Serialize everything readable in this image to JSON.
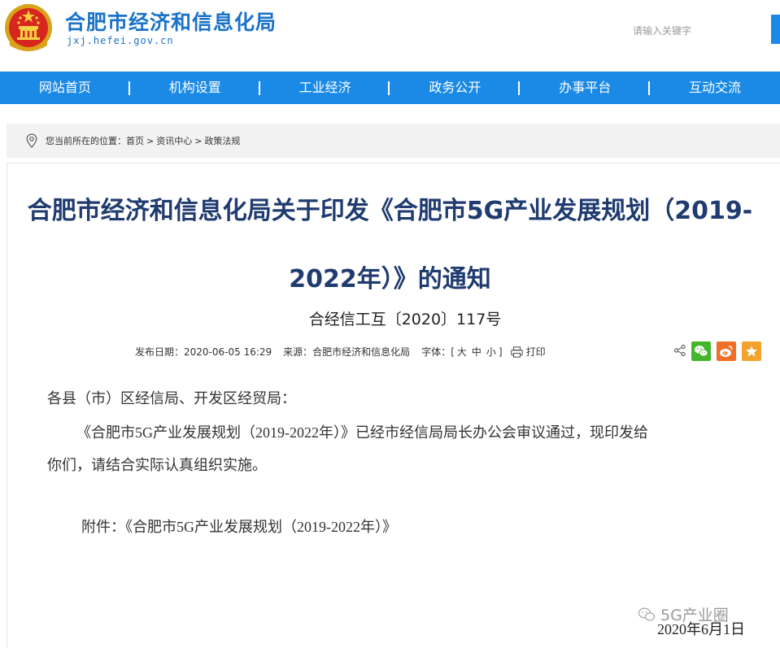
{
  "header": {
    "site_title": "合肥市经济和信息化局",
    "site_domain": "jxj.hefei.gov.cn",
    "search_placeholder": "请输入关键字"
  },
  "nav": {
    "items": [
      "网站首页",
      "机构设置",
      "工业经济",
      "政务公开",
      "办事平台",
      "互动交流"
    ]
  },
  "breadcrumb": {
    "prefix": "您当前所在的位置：",
    "items": [
      "首页",
      "资讯中心",
      "政策法规"
    ],
    "separator": ">"
  },
  "article": {
    "title": "合肥市经济和信息化局关于印发《合肥市5G产业发展规划（2019-2022年）》的通知",
    "doc_number": "合经信工互〔2020〕117号",
    "meta": {
      "date_label": "发布日期：",
      "date_value": "2020-06-05 16:29",
      "source_label": "来源：",
      "source_value": "合肥市经济和信息化局",
      "font_label": "字体：[",
      "font_large": "大",
      "font_medium": "中",
      "font_small": "小",
      "font_close": "]",
      "print_label": "打印"
    },
    "greeting": "各县（市）区经信局、开发区经贸局：",
    "main_line1_serif": "《合肥市5G产业发展规划（2019-2022年）》",
    "main_line1_rest": "已经市经信局局长办公会审议通过，现印发给",
    "main_line2": "你们，请结合实际认真组织实施。",
    "attachment_label": "附件：",
    "attachment_value": "《合肥市5G产业发展规划（2019-2022年）》",
    "date": "2020年6月1日"
  },
  "watermark": {
    "text": "5G产业圈"
  },
  "colors": {
    "brand_blue": "#1a8ae6",
    "title_blue": "#1f3b6f",
    "wechat_green": "#43b62b",
    "weibo_orange": "#f06f28",
    "favorite_yellow": "#f3a22b"
  }
}
